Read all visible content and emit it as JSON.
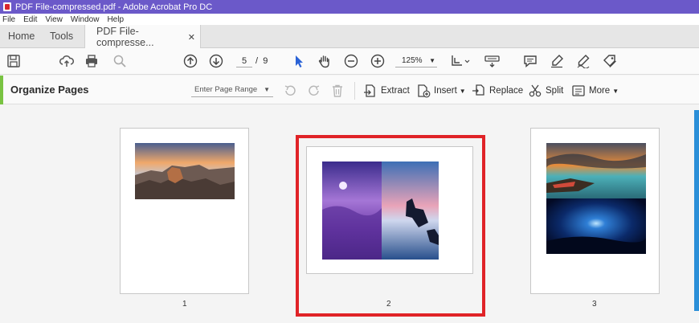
{
  "window": {
    "title": "PDF File-compressed.pdf - Adobe Acrobat Pro DC"
  },
  "menu": [
    "File",
    "Edit",
    "View",
    "Window",
    "Help"
  ],
  "tabs": {
    "home": "Home",
    "tools": "Tools",
    "document": "PDF File-compresse...",
    "close": "✕"
  },
  "toolbar": {
    "current_page": "5",
    "page_separator": "/",
    "total_pages": "9",
    "zoom": "125%"
  },
  "organize": {
    "title": "Organize Pages",
    "range_placeholder": "Enter Page Range",
    "extract": "Extract",
    "insert": "Insert",
    "replace": "Replace",
    "split": "Split",
    "more": "More"
  },
  "pages": [
    {
      "label": "1"
    },
    {
      "label": "2",
      "selected": true
    },
    {
      "label": "3"
    }
  ],
  "colors": {
    "title_bar": "#6b59c9",
    "accent_green": "#79c342",
    "selection_red": "#e02327",
    "scroll_blue": "#2b8fd8"
  }
}
